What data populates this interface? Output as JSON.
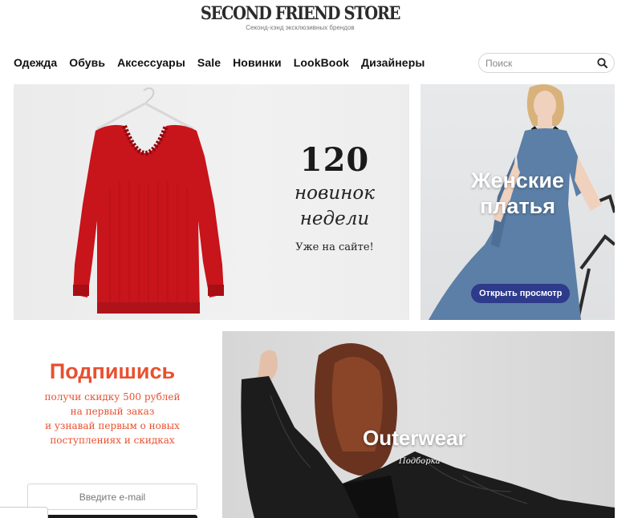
{
  "header": {
    "logo_title": "SECOND FRIEND STORE",
    "logo_subtitle": "Секонд-хэнд эксклюзивных брендов"
  },
  "nav": {
    "items": [
      {
        "label": "Одежда"
      },
      {
        "label": "Обувь"
      },
      {
        "label": "Аксессуары"
      },
      {
        "label": "Sale"
      },
      {
        "label": "Новинки"
      },
      {
        "label": "LookBook"
      },
      {
        "label": "Дизайнеры"
      }
    ]
  },
  "search": {
    "placeholder": "Поиск",
    "value": "",
    "icon": "search-icon"
  },
  "hero": {
    "number": "120",
    "line1": "новинок",
    "line2": "недели",
    "subtitle": "Уже на сайте!",
    "sweater_color": "#c8141b"
  },
  "dresses": {
    "title_line1": "Женские",
    "title_line2": "платья",
    "button_label": "Открыть просмотр",
    "dress_color": "#5b7fa6",
    "button_color": "#2e3a8a"
  },
  "subscribe": {
    "title": "Подпишись",
    "line1": "получи скидку 500 рублей",
    "line2": "на первый заказ",
    "line3": "и узнавай первым о новых",
    "line4": "поступлениях и скидках",
    "email_placeholder": "Введите e-mail",
    "accent_color": "#e8502f"
  },
  "outerwear": {
    "title": "Outerwear",
    "subtitle": "Подборка"
  }
}
